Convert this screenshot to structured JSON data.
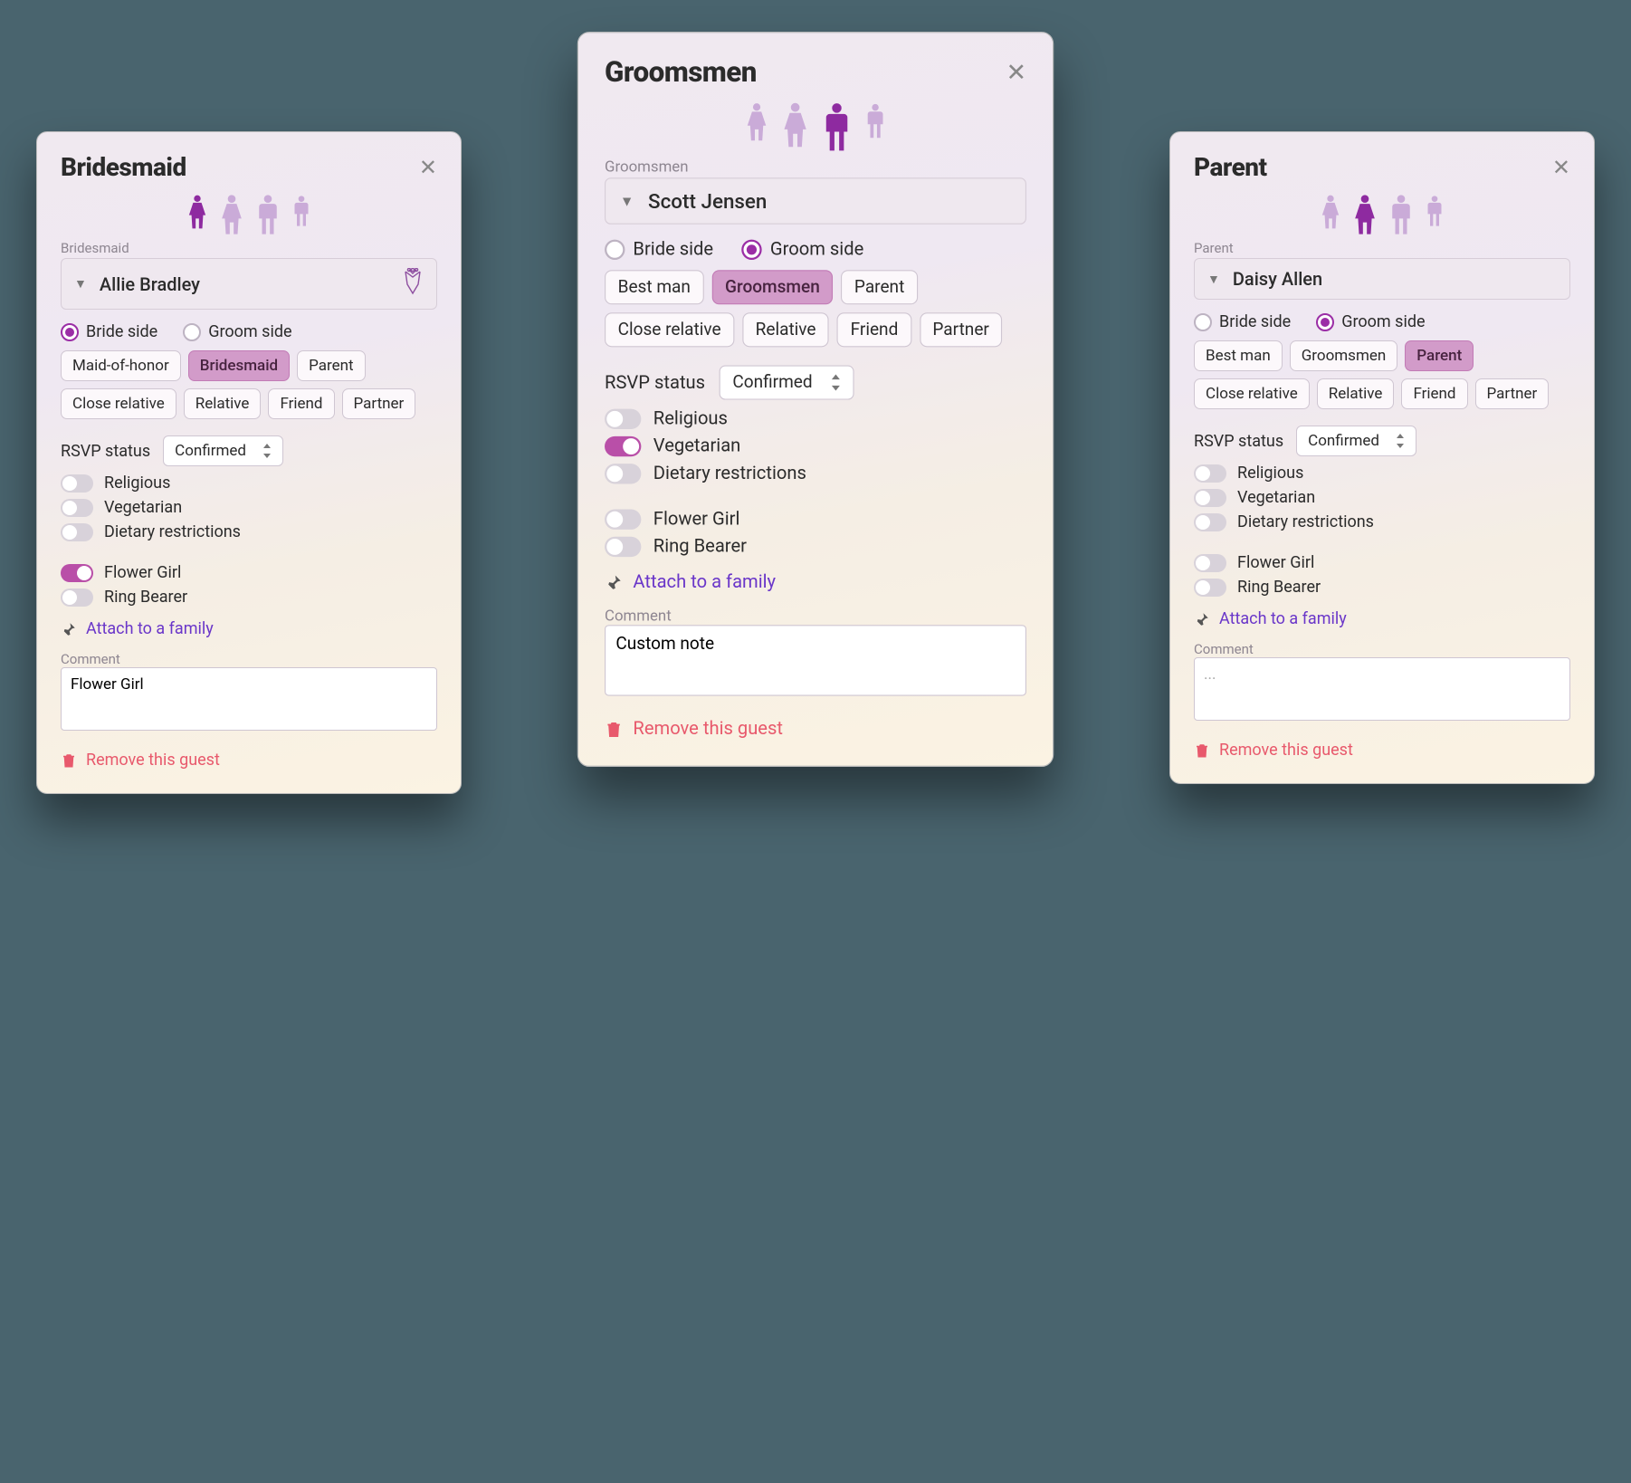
{
  "icons": {
    "girl": "girl-icon",
    "woman": "woman-icon",
    "man": "man-icon",
    "boy": "boy-icon",
    "bouquet": "bouquet-icon"
  },
  "common": {
    "side_bride": "Bride side",
    "side_groom": "Groom side",
    "roles_bride": [
      "Maid-of-honor",
      "Bridesmaid",
      "Parent",
      "Close relative",
      "Relative",
      "Friend",
      "Partner"
    ],
    "roles_groom": [
      "Best man",
      "Groomsmen",
      "Parent",
      "Close relative",
      "Relative",
      "Friend",
      "Partner"
    ],
    "rsvp_label": "RSVP status",
    "rsvp_value": "Confirmed",
    "tog_religious": "Religious",
    "tog_vegetarian": "Vegetarian",
    "tog_dietary": "Dietary restrictions",
    "tog_flowergirl": "Flower Girl",
    "tog_ringbearer": "Ring Bearer",
    "attach_label": "Attach to a family",
    "comment_label": "Comment",
    "remove_label": "Remove this guest"
  },
  "cards": {
    "left": {
      "title": "Bridesmaid",
      "subrole": "Bridesmaid",
      "name": "Allie Bradley",
      "has_flower_badge": true,
      "side_selected": "bride",
      "roles_key": "roles_bride",
      "active_role": "Bridesmaid",
      "toggles": {
        "Religious": false,
        "Vegetarian": false,
        "Dietary restrictions": false,
        "Flower Girl": true,
        "Ring Bearer": false
      },
      "comment": "Flower Girl",
      "figure_active": 0
    },
    "center": {
      "title": "Groomsmen",
      "subrole": "Groomsmen",
      "name": "Scott Jensen",
      "has_flower_badge": false,
      "side_selected": "groom",
      "roles_key": "roles_groom",
      "active_role": "Groomsmen",
      "toggles": {
        "Religious": false,
        "Vegetarian": true,
        "Dietary restrictions": false,
        "Flower Girl": false,
        "Ring Bearer": false
      },
      "comment": "Custom note",
      "figure_active": 2
    },
    "right": {
      "title": "Parent",
      "subrole": "Parent",
      "name": "Daisy Allen",
      "has_flower_badge": false,
      "side_selected": "groom",
      "roles_key": "roles_groom",
      "active_role": "Parent",
      "toggles": {
        "Religious": false,
        "Vegetarian": false,
        "Dietary restrictions": false,
        "Flower Girl": false,
        "Ring Bearer": false
      },
      "comment": "",
      "comment_placeholder": "...",
      "figure_active": 1
    }
  }
}
